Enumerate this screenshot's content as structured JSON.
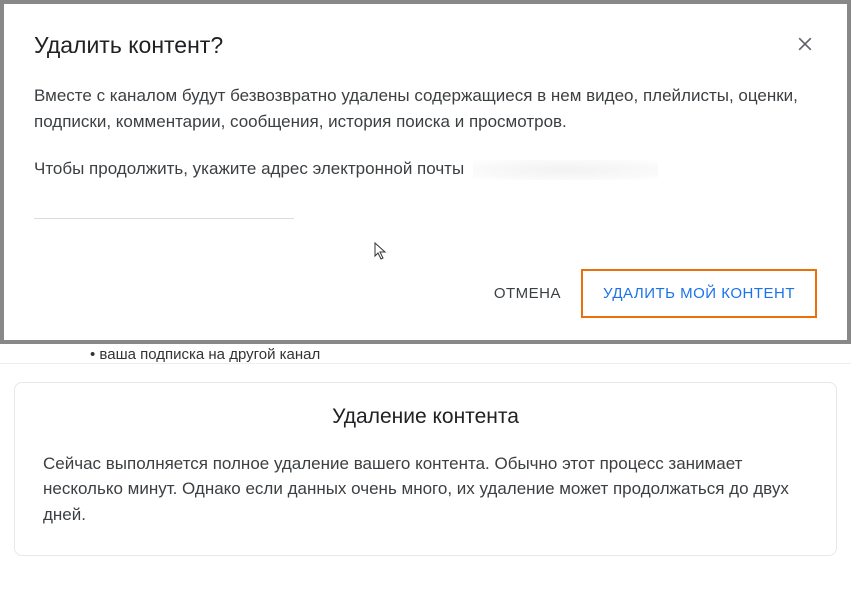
{
  "dialog": {
    "title": "Удалить контент?",
    "body1": "Вместе с каналом будут безвозвратно удалены содержащиеся в нем видео, плейлисты, оценки, подписки, комментарии, сообщения, история поиска и просмотров.",
    "body2_prefix": "Чтобы продолжить, укажите адрес электронной почты",
    "cancel_label": "ОТМЕНА",
    "delete_label": "УДАЛИТЬ МОЙ КОНТЕНТ"
  },
  "behind": {
    "partial_text": "ваша подписка на другой канал"
  },
  "info": {
    "title": "Удаление контента",
    "body": "Сейчас выполняется полное удаление вашего контента. Обычно этот процесс занимает несколько минут. Однако если данных очень много, их удаление может продолжаться до двух дней."
  }
}
